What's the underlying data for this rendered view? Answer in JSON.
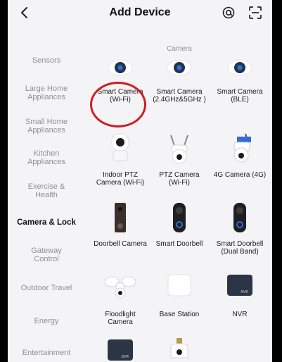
{
  "header": {
    "title": "Add Device"
  },
  "sidebar": {
    "items": [
      {
        "label": "Sensors"
      },
      {
        "label": "Large Home Appliances"
      },
      {
        "label": "Small Home Appliances"
      },
      {
        "label": "Kitchen Appliances"
      },
      {
        "label": "Exercise & Health"
      },
      {
        "label": "Camera & Lock",
        "active": true
      },
      {
        "label": "Gateway Control"
      },
      {
        "label": "Outdoor Travel"
      },
      {
        "label": "Energy"
      },
      {
        "label": "Entertainment"
      }
    ]
  },
  "content": {
    "section_title": "Camera",
    "devices": [
      {
        "label": "Smart Camera (Wi-Fi)",
        "icon": "smart-camera-icon"
      },
      {
        "label": "Smart Camera (2.4GHz&5GHz )",
        "icon": "smart-camera-icon"
      },
      {
        "label": "Smart Camera (BLE)",
        "icon": "smart-camera-icon"
      },
      {
        "label": "Indoor PTZ Camera (Wi-Fi)",
        "icon": "indoor-ptz-camera-icon"
      },
      {
        "label": "PTZ Camera (Wi-Fi)",
        "icon": "ptz-camera-icon"
      },
      {
        "label": "4G Camera (4G)",
        "icon": "4g-camera-icon"
      },
      {
        "label": "Doorbell Camera",
        "icon": "doorbell-camera-icon"
      },
      {
        "label": "Smart Doorbell",
        "icon": "smart-doorbell-icon"
      },
      {
        "label": "Smart Doorbell (Dual Band)",
        "icon": "smart-doorbell-dual-band-icon"
      },
      {
        "label": "Floodlight Camera",
        "icon": "floodlight-camera-icon"
      },
      {
        "label": "Base Station",
        "icon": "base-station-icon"
      },
      {
        "label": "NVR",
        "icon": "nvr-icon",
        "badge": "NVR"
      },
      {
        "label": "",
        "icon": "dvr-icon",
        "badge": "DVR"
      },
      {
        "label": "",
        "icon": "bulb-camera-icon"
      }
    ]
  },
  "colors": {
    "highlight_ring": "#cc1f25",
    "accent_blue": "#2f6fd6"
  }
}
